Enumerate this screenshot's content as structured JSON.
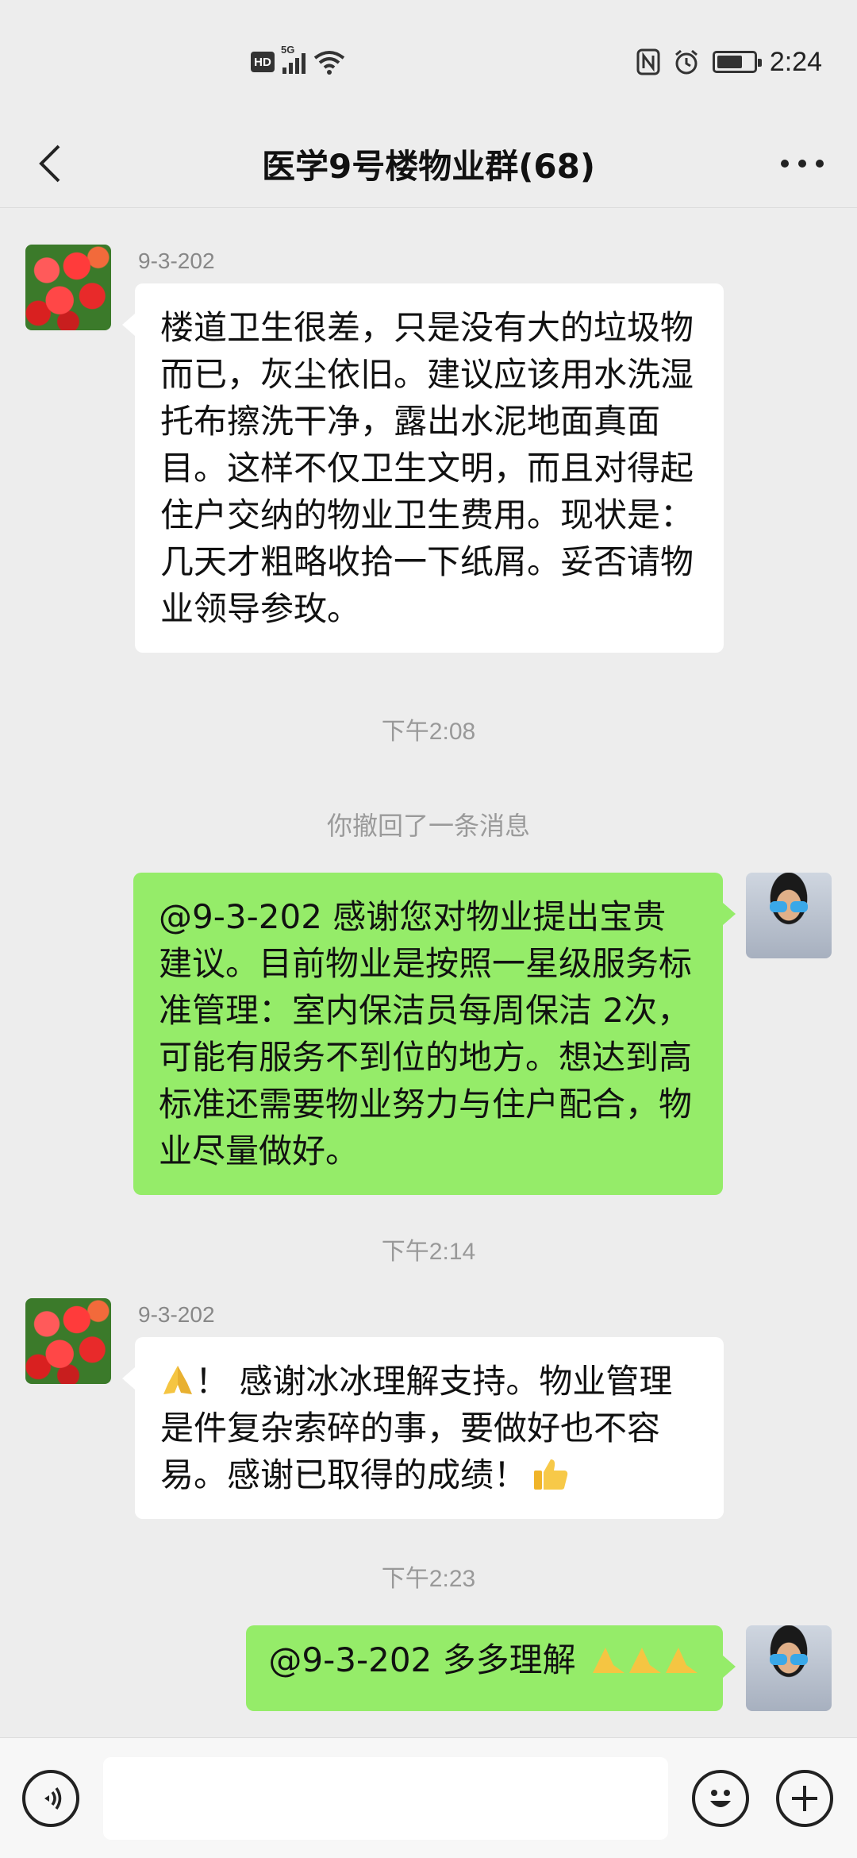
{
  "status_bar": {
    "hd": "HD",
    "network": "5G",
    "nfc": "N",
    "time": "2:24",
    "battery_level_percent": 70
  },
  "nav": {
    "title": "医学9号楼物业群(68)"
  },
  "messages": [
    {
      "sender": "9-3-202",
      "text": "楼道卫生很差，只是没有大的垃圾物而已，灰尘依旧。建议应该用水洗湿托布擦洗干净，露出水泥地面真面目。这样不仅卫生文明，而且对得起住户交纳的物业卫生费用。现状是：几天才粗略收拾一下纸屑。妥否请物业领导参玫。"
    },
    {
      "time": "下午2:08"
    },
    {
      "system": "你撤回了一条消息"
    },
    {
      "text": "@9-3-202  感谢您对物业提出宝贵建议。目前物业是按照一星级服务标准管理：室内保洁员每周保洁 2次，可能有服务不到位的地方。想达到高标准还需要物业努力与住户配合，物业尽量做好。"
    },
    {
      "time": "下午2:14"
    },
    {
      "sender": "9-3-202",
      "text_prefix": "！ 感谢冰冰理解支持。物业管理是件复杂索碎的事，要做好也不容易。感谢已取得的成绩！"
    },
    {
      "time": "下午2:23"
    },
    {
      "text": "@9-3-202  多多理解"
    }
  ],
  "icons": {
    "back": "chevron-left-icon",
    "more": "more-dots-icon",
    "voice": "voice-icon",
    "emoji": "smiley-icon",
    "plus": "plus-icon",
    "pray": "pray-emoji",
    "thumb": "thumbs-up-emoji"
  },
  "colors": {
    "background": "#ededed",
    "outgoing_bubble": "#95ec69",
    "incoming_bubble": "#ffffff"
  }
}
